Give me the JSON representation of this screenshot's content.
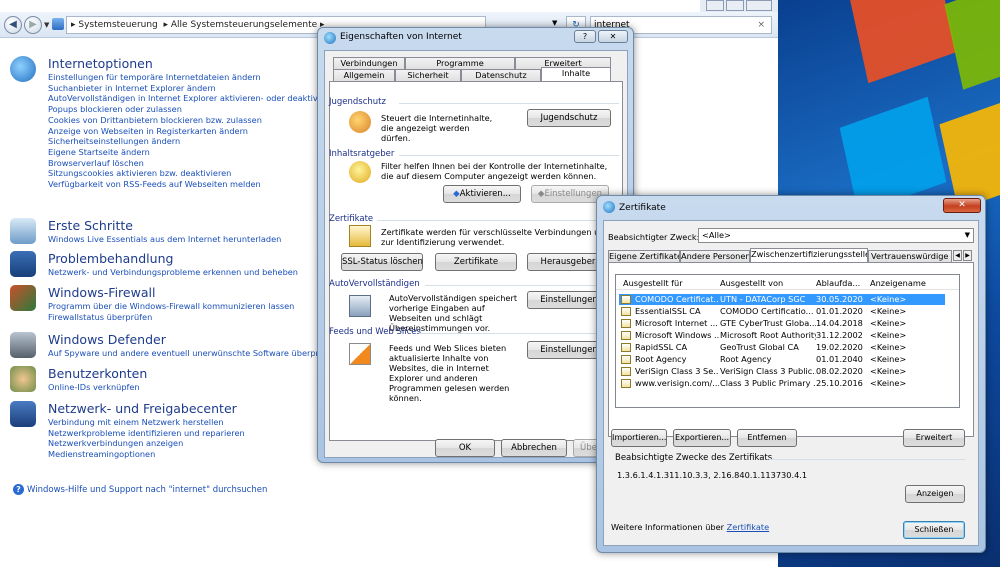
{
  "explorer": {
    "breadcrumb": [
      "Systemsteuerung",
      "Alle Systemsteuerungselemente"
    ],
    "search_value": "internet",
    "categories": [
      {
        "title": "Internetoptionen",
        "links": [
          "Einstellungen für temporäre Internetdateien ändern",
          "Suchanbieter in Internet Explorer ändern",
          "AutoVervollständigen in Internet Explorer aktivieren- oder deaktivieren",
          "Popups blockieren oder zulassen",
          "Cookies von Drittanbietern blockieren bzw. zulassen",
          "Anzeige von Webseiten in Registerkarten ändern",
          "Sicherheitseinstellungen ändern",
          "Eigene Startseite ändern",
          "Browserverlauf löschen",
          "Sitzungscookies aktivieren bzw. deaktivieren",
          "Verfügbarkeit von RSS-Feeds auf Webseiten melden"
        ]
      },
      {
        "title": "Erste Schritte",
        "links": [
          "Windows Live Essentials aus dem Internet herunterladen"
        ]
      },
      {
        "title": "Problembehandlung",
        "links": [
          "Netzwerk- und Verbindungsprobleme erkennen und beheben"
        ]
      },
      {
        "title": "Windows-Firewall",
        "links": [
          "Programm über die Windows-Firewall kommunizieren lassen",
          "Firewallstatus überprüfen"
        ]
      },
      {
        "title": "Windows Defender",
        "links": [
          "Auf Spyware und andere eventuell unerwünschte Software überprüfen"
        ]
      },
      {
        "title": "Benutzerkonten",
        "links": [
          "Online-IDs verknüpfen"
        ]
      },
      {
        "title": "Netzwerk- und Freigabecenter",
        "links": [
          "Verbindung mit einem Netzwerk herstellen",
          "Netzwerkprobleme identifizieren und reparieren",
          "Netzwerkverbindungen anzeigen",
          "Medienstreamingoptionen"
        ]
      }
    ],
    "help_link": "Windows-Hilfe und Support nach \"internet\" durchsuchen"
  },
  "inet_dialog": {
    "title": "Eigenschaften von Internet",
    "tabs_row1": [
      "Verbindungen",
      "Programme",
      "Erweitert"
    ],
    "tabs_row2": [
      "Allgemein",
      "Sicherheit",
      "Datenschutz",
      "Inhalte"
    ],
    "jugendschutz": {
      "group": "Jugendschutz",
      "text": "Steuert die Internetinhalte, die angezeigt werden dürfen.",
      "button": "Jugendschutz"
    },
    "inhaltsratgeber": {
      "group": "Inhaltsratgeber",
      "text": "Filter helfen Ihnen bei der Kontrolle der Internetinhalte, die auf diesem Computer angezeigt werden können.",
      "activate": "Aktivieren...",
      "settings": "Einstellungen"
    },
    "zertifikate": {
      "group": "Zertifikate",
      "text": "Zertifikate werden für verschlüsselte Verbindungen und zur Identifizierung verwendet.",
      "ssl": "SSL-Status löschen",
      "certs": "Zertifikate",
      "publisher": "Herausgeber"
    },
    "autocomplete": {
      "group": "AutoVervollständigen",
      "text": "AutoVervollständigen speichert vorherige Eingaben auf Webseiten und schlägt Übereinstimmungen vor.",
      "button": "Einstellungen"
    },
    "feeds": {
      "group": "Feeds und Web Slices",
      "text": "Feeds und Web Slices bieten aktualisierte Inhalte von Websites, die in Internet Explorer und anderen Programmen gelesen werden können.",
      "button": "Einstellungen"
    },
    "ok": "OK",
    "cancel": "Abbrechen",
    "apply": "Übern"
  },
  "cert_dialog": {
    "title": "Zertifikate",
    "purpose_label": "Beabsichtigter Zweck:",
    "purpose_value": "<Alle>",
    "tabs": [
      "Eigene Zertifikate",
      "Andere Personen",
      "Zwischenzertifizierungsstellen",
      "Vertrauenswürdige"
    ],
    "columns": [
      "Ausgestellt für",
      "Ausgestellt von",
      "Ablaufda...",
      "Anzeigename"
    ],
    "rows": [
      [
        "COMODO Certificat...",
        "UTN - DATACorp SGC",
        "30.05.2020",
        "<Keine>"
      ],
      [
        "EssentialSSL CA",
        "COMODO Certificatio...",
        "01.01.2020",
        "<Keine>"
      ],
      [
        "Microsoft Internet ...",
        "GTE CyberTrust Globa...",
        "14.04.2018",
        "<Keine>"
      ],
      [
        "Microsoft Windows ...",
        "Microsoft Root Authority",
        "31.12.2002",
        "<Keine>"
      ],
      [
        "RapidSSL CA",
        "GeoTrust Global CA",
        "19.02.2020",
        "<Keine>"
      ],
      [
        "Root Agency",
        "Root Agency",
        "01.01.2040",
        "<Keine>"
      ],
      [
        "VeriSign Class 3 Se...",
        "VeriSign Class 3 Public...",
        "08.02.2020",
        "<Keine>"
      ],
      [
        "www.verisign.com/...",
        "Class 3 Public Primary ...",
        "25.10.2016",
        "<Keine>"
      ]
    ],
    "import": "Importieren...",
    "export": "Exportieren...",
    "remove": "Entfernen",
    "advanced": "Erweitert",
    "purposes_group": "Beabsichtigte Zwecke des Zertifikats",
    "purposes_value": "1.3.6.1.4.1.311.10.3.3, 2.16.840.1.113730.4.1",
    "view": "Anzeigen",
    "more_info": "Weitere Informationen über",
    "more_info_link": "Zertifikate",
    "close": "Schließen"
  }
}
